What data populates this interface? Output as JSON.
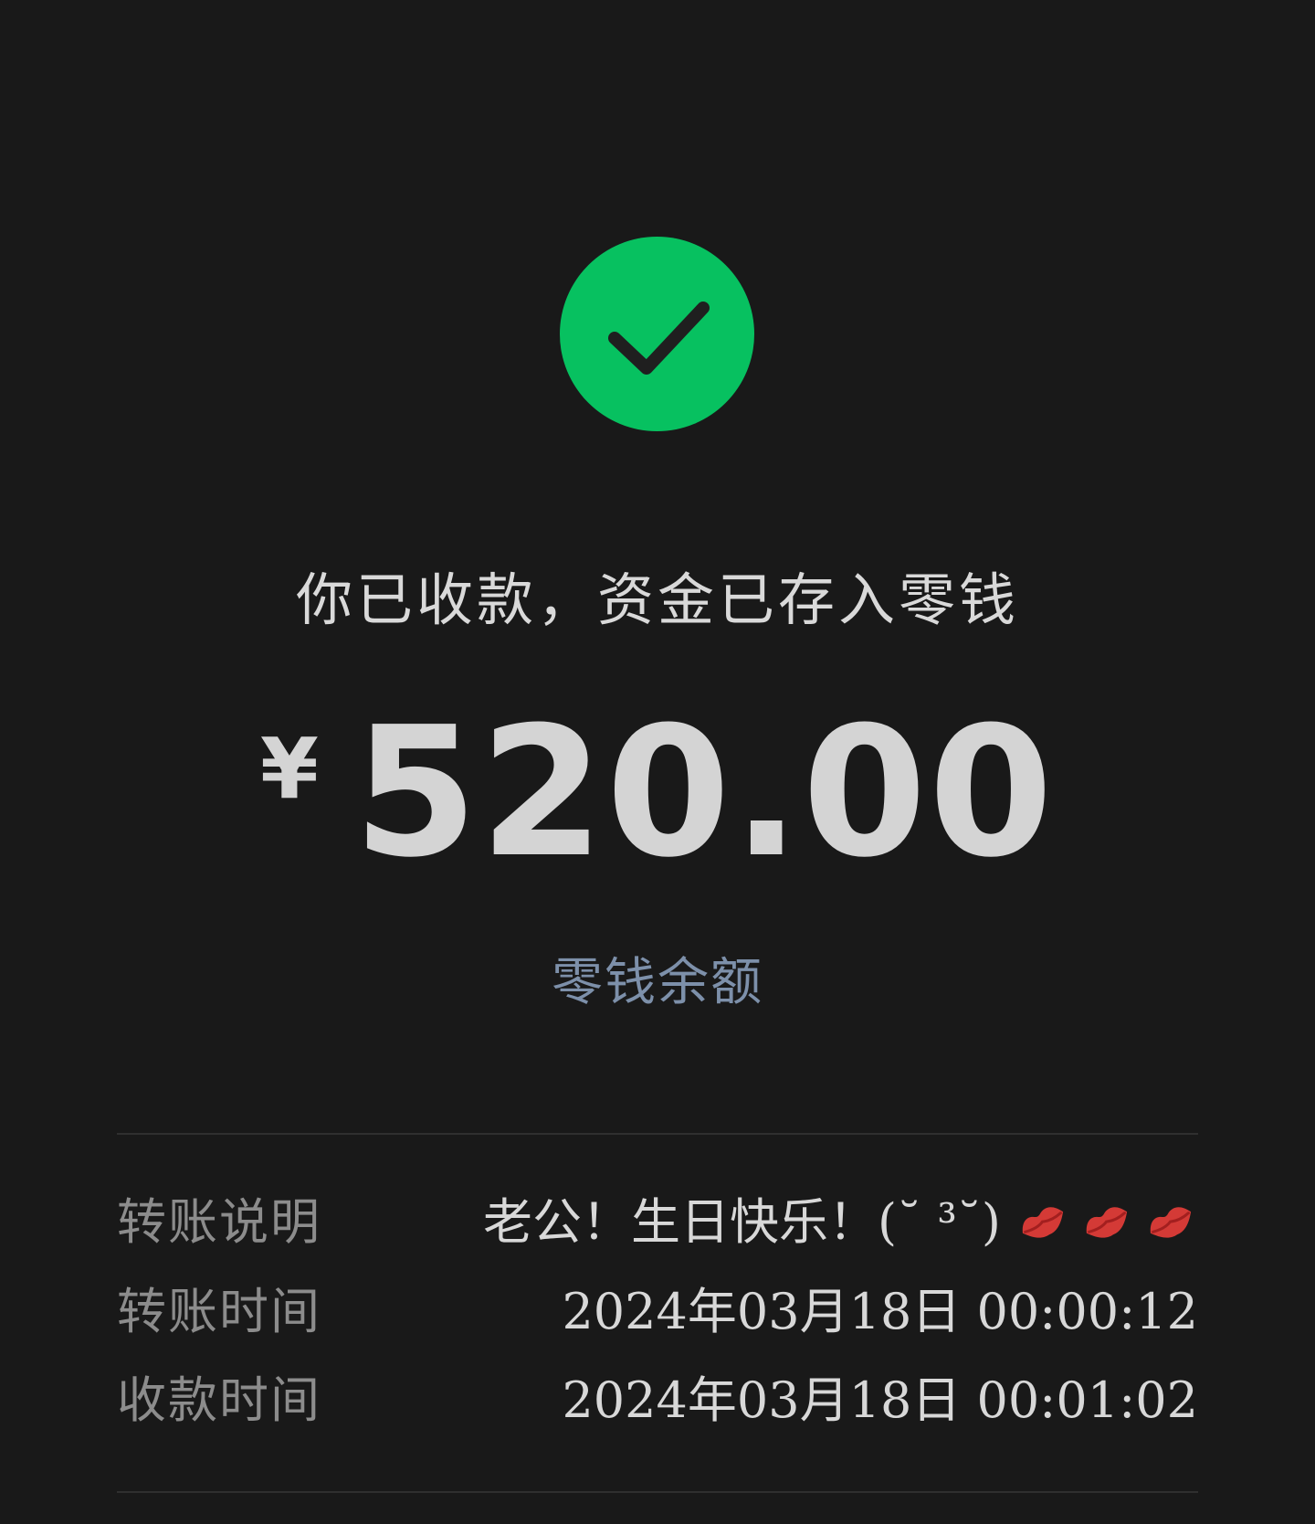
{
  "status": {
    "icon": "check-circle-icon",
    "text": "你已收款，资金已存入零钱",
    "success_color": "#07c160"
  },
  "amount": {
    "currency": "¥",
    "value": "520.00"
  },
  "balance": {
    "label": "零钱余额"
  },
  "details": {
    "note_label": "转账说明",
    "note_value": "老公！生日快乐！(˘ ³˘)",
    "note_emoji": [
      "lips-icon",
      "lips-icon",
      "lips-icon"
    ],
    "transfer_time_label": "转账时间",
    "transfer_time_value": "2024年03月18日 00:00:12",
    "receive_time_label": "收款时间",
    "receive_time_value": "2024年03月18日 00:01:02"
  },
  "colors": {
    "background": "#191919",
    "link": "#7d90aa"
  }
}
